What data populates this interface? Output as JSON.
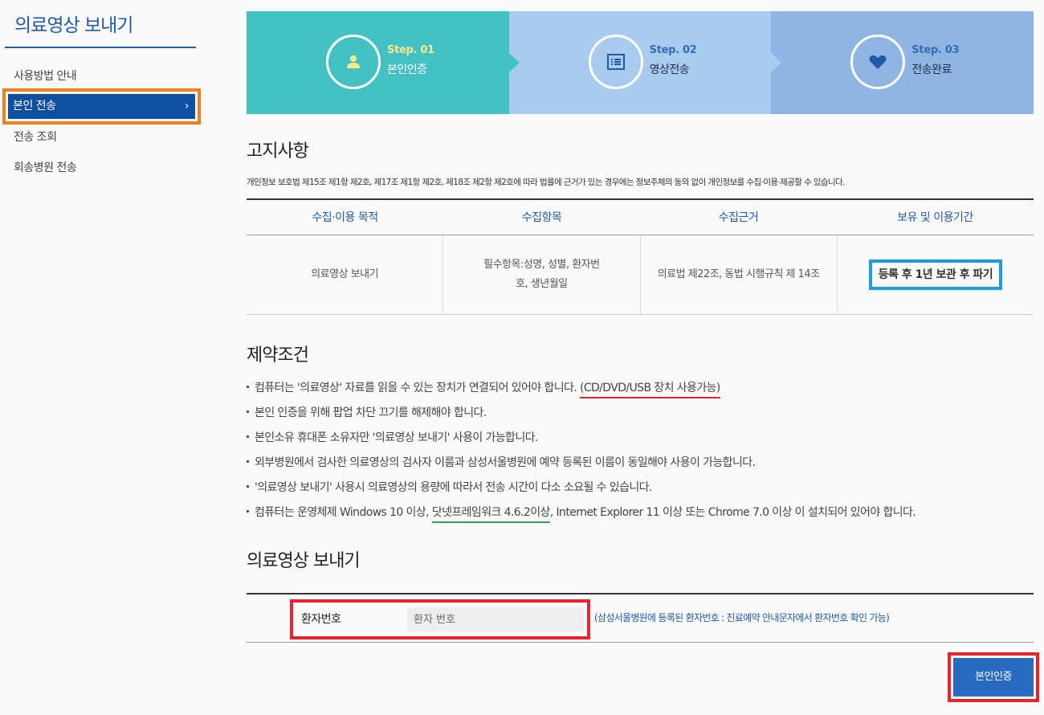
{
  "sidebar": {
    "title": "의료영상 보내기",
    "items": [
      {
        "label": "사용방법 안내"
      },
      {
        "label": "본인 전송",
        "chevron": "›"
      },
      {
        "label": "전송 조회"
      },
      {
        "label": "회송병원 전송"
      }
    ]
  },
  "steps": [
    {
      "num": "Step. 01",
      "label": "본인인증",
      "icon": "user-icon"
    },
    {
      "num": "Step. 02",
      "label": "영상전송",
      "icon": "list-icon"
    },
    {
      "num": "Step. 03",
      "label": "전송완료",
      "icon": "heart-icon"
    }
  ],
  "notice": {
    "heading": "고지사항",
    "text": "개인정보 보호법 제15조 제1항 제2호, 제17조 제1항 제2호, 제18조 제2항 제2호에 따라 법률에 근거가 있는 경우에는 정보주체의 동의 없이 개인정보를 수집·이용·제공할 수 있습니다.",
    "headers": [
      "수집·이용 목적",
      "수집항목",
      "수집근거",
      "보유 및 이용기간"
    ],
    "row": {
      "purpose": "의료영상 보내기",
      "items": "필수항목:성명, 성별, 환자번호, 생년월일",
      "basis": "의료법 제22조, 동법 시행규칙 제 14조",
      "retention": "등록 후 1년 보관 후 파기"
    }
  },
  "conditions": {
    "heading": "제약조건",
    "items": [
      {
        "pre": "컴퓨터는 '의료영상' 자료를 읽을 수 있는 장치가 연결되어 있어야 합니다. ",
        "hl": "(CD/DVD/USB 장치 사용가능)",
        "post": ""
      },
      {
        "pre": "본인 인증을 위해 팝업 차단 끄기를 해제해야 합니다.",
        "hl": "",
        "post": ""
      },
      {
        "pre": "본인소유 휴대폰 소유자만 '의료영상 보내기' 사용이 가능합니다.",
        "hl": "",
        "post": ""
      },
      {
        "pre": "외부병원에서 검사한 의료영상의 검사자 이름과 삼성서울병원에 예약 등록된 이름이 동일해야 사용이 가능합니다.",
        "hl": "",
        "post": ""
      },
      {
        "pre": "'의료영상 보내기' 사용시 의료영상의 용량에 따라서 전송 시간이 다소 소요될 수 있습니다.",
        "hl": "",
        "post": ""
      },
      {
        "pre": "컴퓨터는 운영체제 Windows 10 이상, ",
        "hl": "닷넷프레임워크 4.6.2이상",
        "post": ", Internet Explorer 11 이상 또는 Chrome 7.0 이상 이 설치되어 있어야 합니다."
      }
    ]
  },
  "send": {
    "heading": "의료영상 보내기",
    "label": "환자번호",
    "placeholder": "환자 번호",
    "value": "",
    "help": "(삼성서울병원에 등록된 환자번호 : 진료예약 안내문자에서 환자번호 확인 가능)",
    "submit": "본인인증"
  },
  "colors": {
    "brand": "#1e5aa8",
    "step1": "#43c1c3",
    "step2": "#a9cbee",
    "step3": "#90b5e2",
    "highlight_orange": "#f07f1f",
    "highlight_red": "#e3262d",
    "highlight_blue": "#1a9fe0",
    "underline_green": "#2aa84a"
  }
}
